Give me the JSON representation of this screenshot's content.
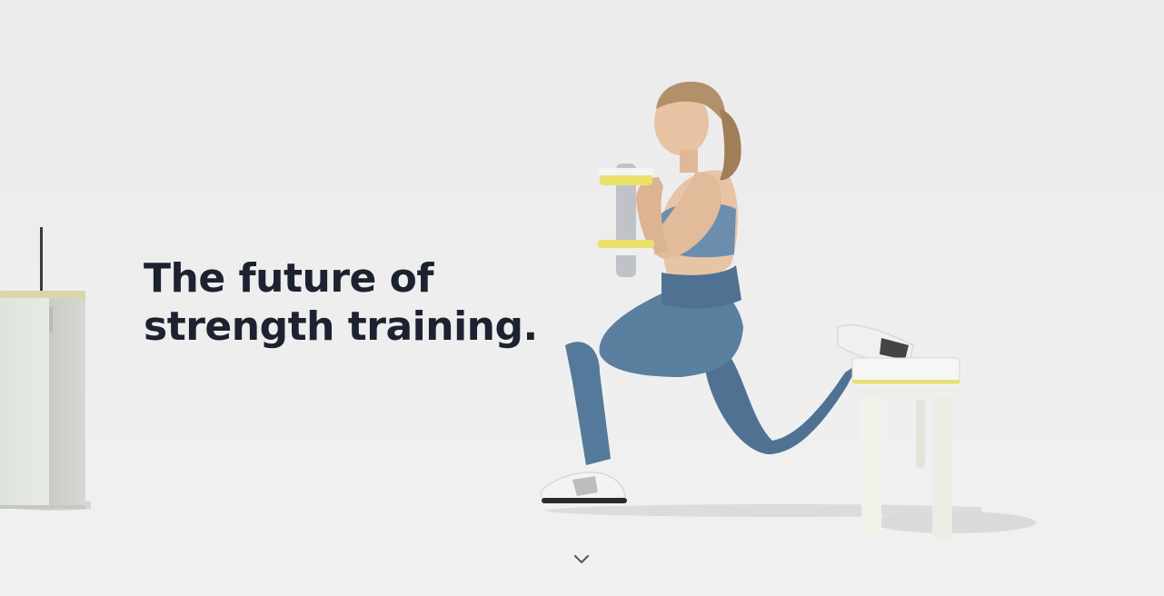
{
  "hero": {
    "headline_line1": "The future of",
    "headline_line2": "strength training."
  },
  "colors": {
    "background": "#ededed",
    "headline": "#1c2230",
    "leggings": "#5a7f9f",
    "accent_yellow": "#e9e16a",
    "chevron": "#4a5468"
  },
  "icons": {
    "scroll": "chevron-down-icon"
  }
}
